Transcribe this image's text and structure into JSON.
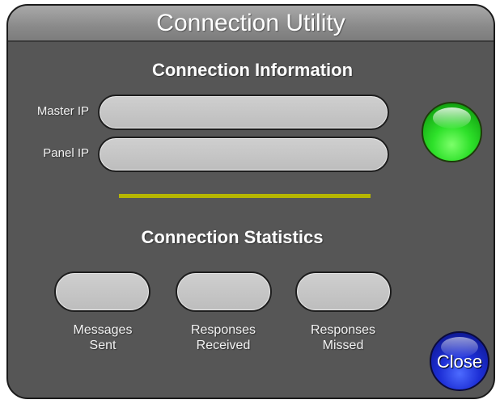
{
  "window": {
    "title": "Connection Utility"
  },
  "connection_info": {
    "heading": "Connection Information",
    "master_ip": {
      "label": "Master IP",
      "value": ""
    },
    "panel_ip": {
      "label": "Panel IP",
      "value": ""
    },
    "status_led": {
      "state": "connected",
      "color": "#2ee12a"
    }
  },
  "divider": {
    "color": "#b6b600"
  },
  "connection_stats": {
    "heading": "Connection Statistics",
    "messages_sent": {
      "label_line1": "Messages",
      "label_line2": "Sent",
      "value": ""
    },
    "responses_received": {
      "label_line1": "Responses",
      "label_line2": "Received",
      "value": ""
    },
    "responses_missed": {
      "label_line1": "Responses",
      "label_line2": "Missed",
      "value": ""
    }
  },
  "close_button": {
    "label": "Close",
    "color": "#1d2fd6"
  }
}
